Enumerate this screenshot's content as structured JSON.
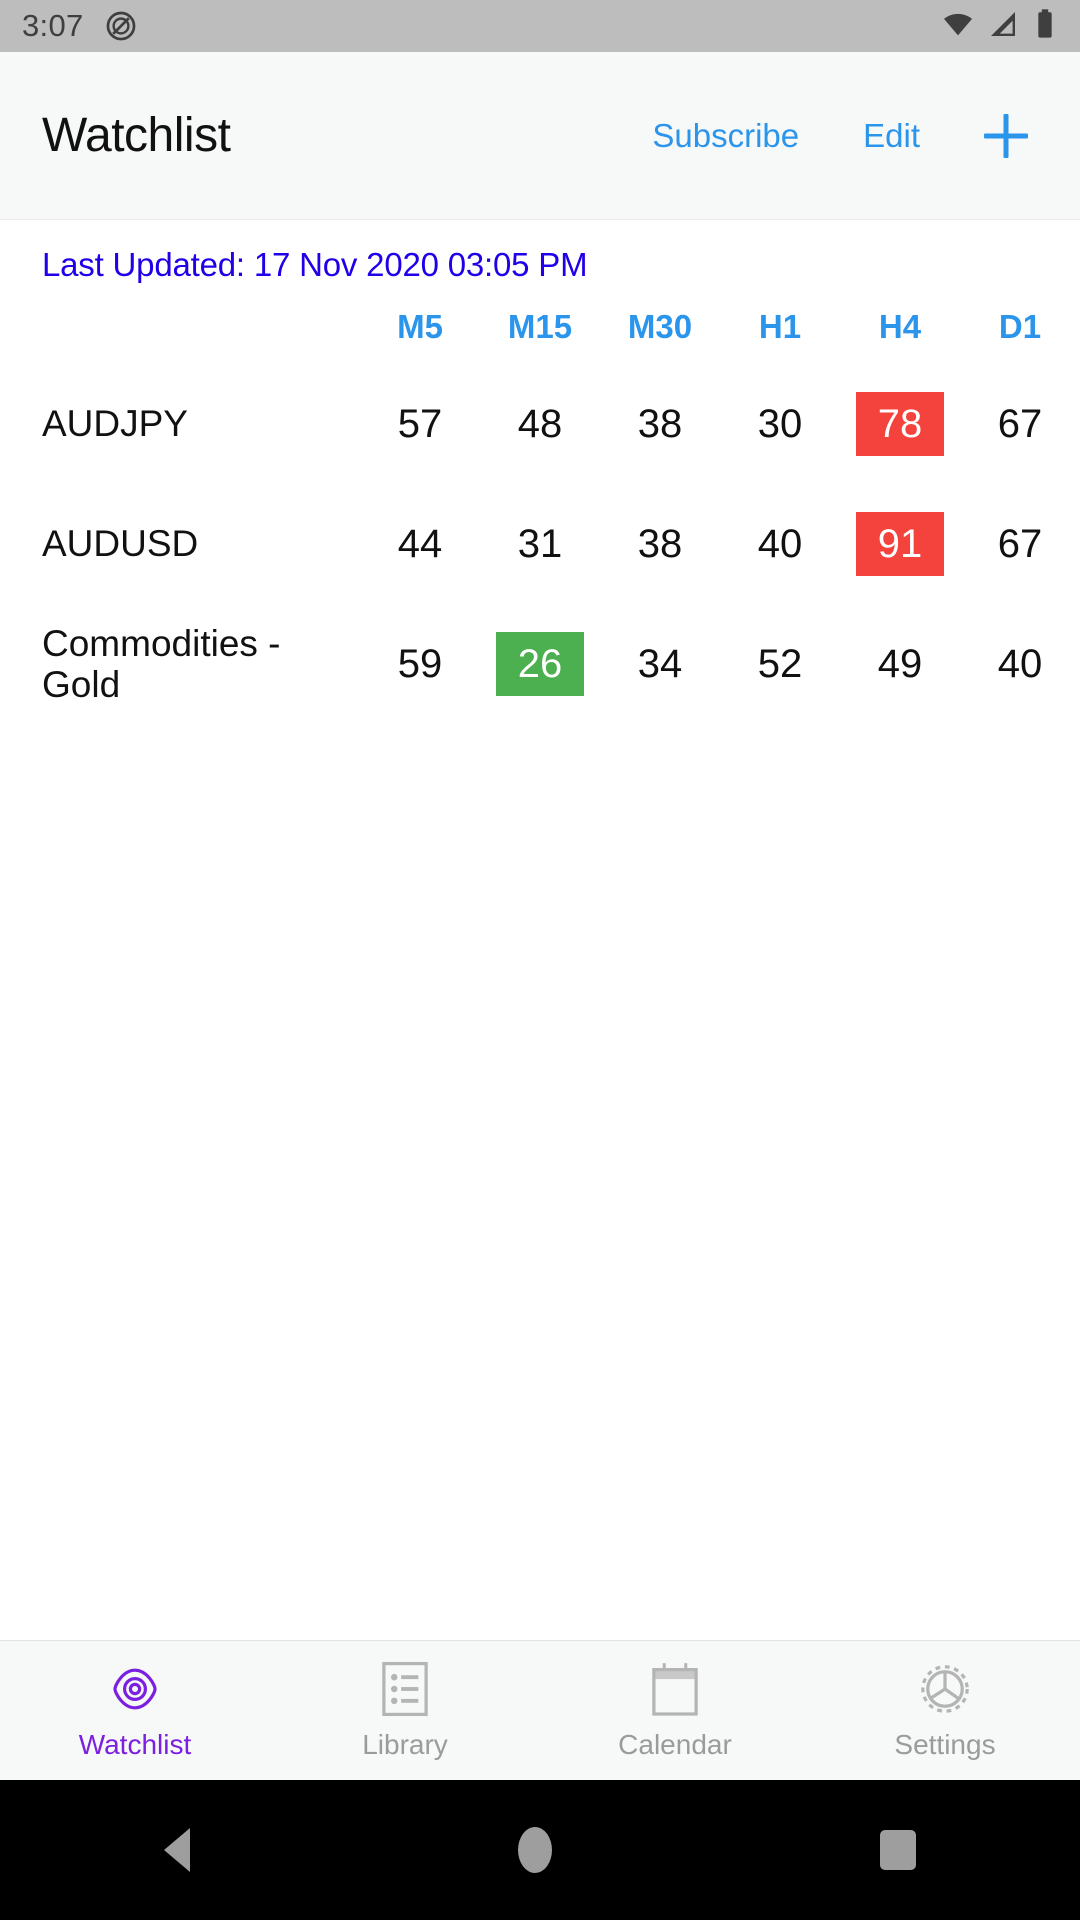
{
  "status_bar": {
    "time": "3:07",
    "icons": [
      "do-not-disturb-icon",
      "wifi-icon",
      "cellular-signal-icon",
      "battery-icon"
    ]
  },
  "app_bar": {
    "title": "Watchlist",
    "subscribe_label": "Subscribe",
    "edit_label": "Edit",
    "add_icon": "plus-icon",
    "accent_color": "#2b95ec"
  },
  "content": {
    "last_updated": "Last Updated: 17 Nov 2020 03:05 PM",
    "last_updated_color": "#2000e8"
  },
  "table": {
    "symbol_header": "",
    "columns": [
      "M5",
      "M15",
      "M30",
      "H1",
      "H4",
      "D1"
    ],
    "rows": [
      {
        "symbol": "AUDJPY",
        "values": [
          "57",
          "48",
          "38",
          "30",
          "78",
          "67"
        ],
        "highlights": [
          null,
          null,
          null,
          null,
          "red",
          null
        ]
      },
      {
        "symbol": "AUDUSD",
        "values": [
          "44",
          "31",
          "38",
          "40",
          "91",
          "67"
        ],
        "highlights": [
          null,
          null,
          null,
          null,
          "red",
          null
        ]
      },
      {
        "symbol": "Commodities - Gold",
        "values": [
          "59",
          "26",
          "34",
          "52",
          "49",
          "40"
        ],
        "highlights": [
          null,
          "green",
          null,
          null,
          null,
          null
        ]
      }
    ],
    "highlight_colors": {
      "red": "#f4433c",
      "green": "#4caf50"
    }
  },
  "tab_bar": {
    "active_color": "#7b1fe0",
    "inactive_color": "#9b9b9b",
    "tabs": [
      {
        "label": "Watchlist",
        "icon": "eye-icon",
        "active": true
      },
      {
        "label": "Library",
        "icon": "list-icon",
        "active": false
      },
      {
        "label": "Calendar",
        "icon": "calendar-icon",
        "active": false
      },
      {
        "label": "Settings",
        "icon": "gear-icon",
        "active": false
      }
    ]
  },
  "nav_bar": {
    "back": "back-triangle-icon",
    "home": "home-circle-icon",
    "recents": "recents-square-icon"
  }
}
